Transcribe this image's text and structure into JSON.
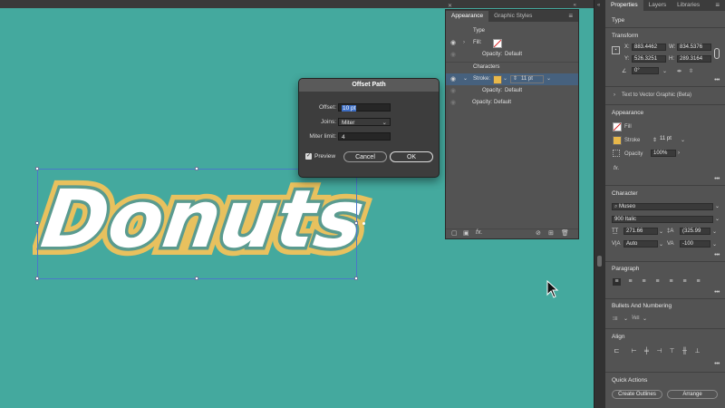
{
  "canvas": {
    "artwork_text": "Donuts",
    "bg_color": "#44a99e",
    "text_fill": "#ffffff",
    "stroke_color": "#e8c15e",
    "outline_color": "#5a9b8f"
  },
  "appearance_panel": {
    "tabs": [
      "Appearance",
      "Graphic Styles"
    ],
    "rows": {
      "type": "Type",
      "fill_label": "Fill:",
      "opacity1_label": "Opacity:",
      "opacity1_value": "Default",
      "characters": "Characters",
      "stroke_label": "Stroke:",
      "stroke_weight": "11 pt",
      "opacity2_label": "Opacity:",
      "opacity2_value": "Default",
      "opacity3_label": "Opacity:",
      "opacity3_value": "Default"
    }
  },
  "offset_dialog": {
    "title": "Offset Path",
    "offset_label": "Offset:",
    "offset_value": "10 pt",
    "joins_label": "Joins:",
    "joins_value": "Miter",
    "miter_label": "Miter limit:",
    "miter_value": "4",
    "preview_label": "Preview",
    "preview_checked": true,
    "cancel_label": "Cancel",
    "ok_label": "OK"
  },
  "properties_panel": {
    "tabs": [
      "Properties",
      "Layers",
      "Libraries"
    ],
    "type_heading": "Type",
    "transform_heading": "Transform",
    "x_label": "X:",
    "x_value": "883.4462",
    "w_label": "W:",
    "w_value": "834.5376",
    "y_label": "Y:",
    "y_value": "526.3251",
    "h_label": "H:",
    "h_value": "289.3164",
    "angle_value": "0°",
    "text_to_vector": "Text to Vector Graphic (Beta)",
    "appearance_heading": "Appearance",
    "fill_label": "Fill",
    "stroke_label": "Stroke",
    "stroke_value": "11 pt",
    "opacity_label": "Opacity",
    "opacity_value": "100%",
    "character_heading": "Character",
    "font_name": "Museo",
    "font_style": "900 Italic",
    "font_size": "271.66",
    "leading": "(325.99",
    "kerning": "Auto",
    "tracking": "-100",
    "paragraph_heading": "Paragraph",
    "bullets_heading": "Bullets And Numbering",
    "align_heading": "Align",
    "quick_actions_heading": "Quick Actions",
    "create_outlines_label": "Create Outlines",
    "arrange_label": "Arrange"
  }
}
